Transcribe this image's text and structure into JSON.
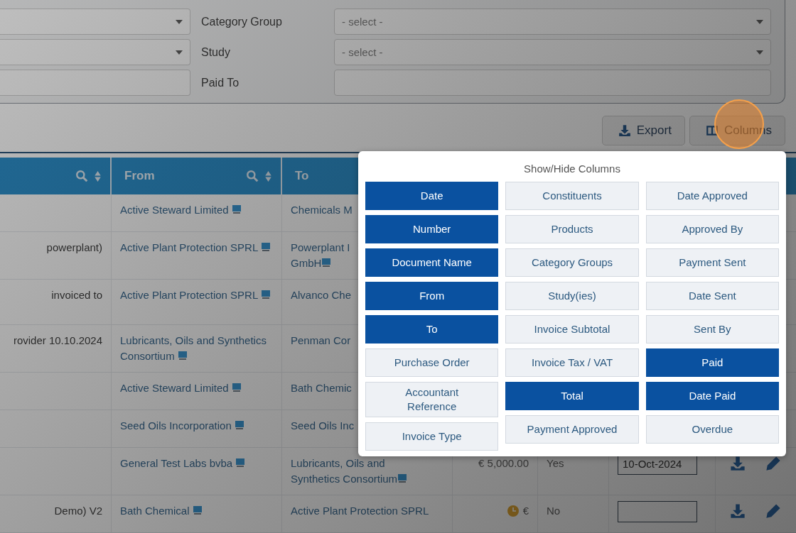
{
  "filters": [
    {
      "left": {
        "kind": "select"
      },
      "label": "Category Group",
      "field": {
        "kind": "select",
        "value": "- select -"
      }
    },
    {
      "left": {
        "kind": "select"
      },
      "label": "Study",
      "field": {
        "kind": "select",
        "value": "- select -"
      }
    },
    {
      "left": {
        "kind": "input"
      },
      "label": "Paid To",
      "field": {
        "kind": "input"
      }
    }
  ],
  "toolbar": [
    {
      "kind": "export",
      "label": "Export"
    },
    {
      "kind": "columns",
      "label": "Columns"
    }
  ],
  "table": {
    "columns": [
      {
        "searchable": true
      },
      {
        "label": "From",
        "searchable": true
      },
      {
        "label": "To"
      }
    ],
    "rows": [
      {
        "column_1": "",
        "from": "Active Steward Limited",
        "to": {
          "lines": [
            "Chemicals M"
          ],
          "icon": false
        }
      },
      {
        "column_1": "powerplant)",
        "from": "Active Plant Protection SPRL",
        "to": {
          "lines": [
            "Powerplant I",
            "GmbH"
          ],
          "icon": true
        }
      },
      {
        "column_1": " invoiced to",
        "from": "Active Plant Protection SPRL",
        "to": {
          "lines": [
            "Alvanco Che"
          ],
          "icon": false
        }
      },
      {
        "column_1": "rovider 10.10.2024",
        "from": "Lubricants, Oils and Synthetics Consortium",
        "to": {
          "lines": [
            "Penman Cor"
          ],
          "icon": false
        }
      },
      {
        "column_1": "",
        "from": "Active Steward Limited",
        "to": {
          "lines": [
            "Bath Chemic"
          ],
          "icon": false
        }
      },
      {
        "column_1": "",
        "from": "Seed Oils Incorporation",
        "to": {
          "lines": [
            "Seed Oils Inc"
          ],
          "icon": false
        }
      },
      {
        "column_1": "",
        "from": "General Test Labs bvba",
        "to": {
          "lines": [
            "Lubricants, Oils and",
            "Synthetics Consortium"
          ],
          "icon": true
        },
        "amount": "€ 5,000.00",
        "overdue_icon": false,
        "paid": "Yes",
        "date_paid": "10-Oct-2024",
        "actions": true
      },
      {
        "column_1": "Demo) V2",
        "from": "Bath Chemical",
        "to": {
          "lines": [
            "Active Plant Protection SPRL"
          ],
          "icon": false
        },
        "amount": "€",
        "overdue_icon": true,
        "paid": "No",
        "date_paid": "",
        "actions": true
      }
    ]
  },
  "column_picker": {
    "title": "Show/Hide Columns",
    "groups": [
      {
        "items": [
          {
            "label": "Date",
            "selected": true
          },
          {
            "label": "Number",
            "selected": true
          },
          {
            "label": "Document Name",
            "selected": true
          },
          {
            "label": "From",
            "selected": true
          },
          {
            "label": "To",
            "selected": true
          },
          {
            "label": "Purchase Order",
            "selected": false
          },
          {
            "label": "Accountant Reference",
            "selected": false
          },
          {
            "label": "Invoice Type",
            "selected": false
          }
        ]
      },
      {
        "items": [
          {
            "label": "Constituents",
            "selected": false
          },
          {
            "label": "Products",
            "selected": false
          },
          {
            "label": "Category Groups",
            "selected": false
          },
          {
            "label": "Study(ies)",
            "selected": false
          },
          {
            "label": "Invoice Subtotal",
            "selected": false
          },
          {
            "label": "Invoice Tax / VAT",
            "selected": false
          },
          {
            "label": "Total",
            "selected": true
          },
          {
            "label": "Payment Approved",
            "selected": false
          }
        ]
      },
      {
        "items": [
          {
            "label": "Date Approved",
            "selected": false
          },
          {
            "label": "Approved By",
            "selected": false
          },
          {
            "label": "Payment Sent",
            "selected": false
          },
          {
            "label": "Date Sent",
            "selected": false
          },
          {
            "label": "Sent By",
            "selected": false
          },
          {
            "label": "Paid",
            "selected": true
          },
          {
            "label": "Date Paid",
            "selected": true
          },
          {
            "label": "Overdue",
            "selected": false
          }
        ]
      }
    ]
  }
}
